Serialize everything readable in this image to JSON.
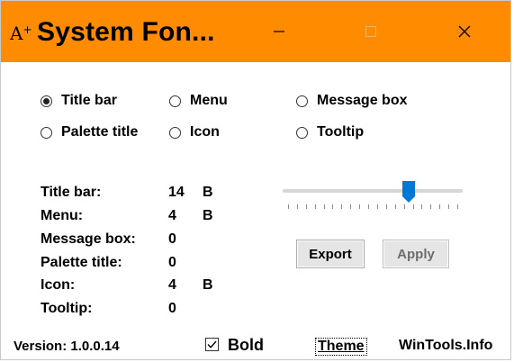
{
  "window": {
    "title": "System Fon...",
    "icon_glyph": "A",
    "icon_plus": "+",
    "icon_name": "font-app-icon",
    "accent_color": "#ff8c00",
    "controls": {
      "minimize": "–",
      "maximize": "□",
      "close": "✕"
    }
  },
  "radios": [
    {
      "label": "Title bar",
      "checked": true
    },
    {
      "label": "Menu",
      "checked": false
    },
    {
      "label": "Message box",
      "checked": false
    },
    {
      "label": "Palette title",
      "checked": false
    },
    {
      "label": "Icon",
      "checked": false
    },
    {
      "label": "Tooltip",
      "checked": false
    }
  ],
  "stats": [
    {
      "label": "Title bar:",
      "value": "14",
      "bold": "B"
    },
    {
      "label": "Menu:",
      "value": "4",
      "bold": "B"
    },
    {
      "label": "Message box:",
      "value": "0",
      "bold": ""
    },
    {
      "label": "Palette title:",
      "value": "0",
      "bold": ""
    },
    {
      "label": "Icon:",
      "value": "4",
      "bold": "B"
    },
    {
      "label": "Tooltip:",
      "value": "0",
      "bold": ""
    }
  ],
  "slider": {
    "level_fraction": 0.7,
    "ticks": 20,
    "thumb_color": "#0078d7"
  },
  "buttons": {
    "export": "Export",
    "apply": "Apply"
  },
  "footer": {
    "version": "Version: 1.0.0.14",
    "bold_checkbox_checked": true,
    "bold_label": "Bold",
    "theme": "Theme",
    "site": "WinTools.Info"
  }
}
